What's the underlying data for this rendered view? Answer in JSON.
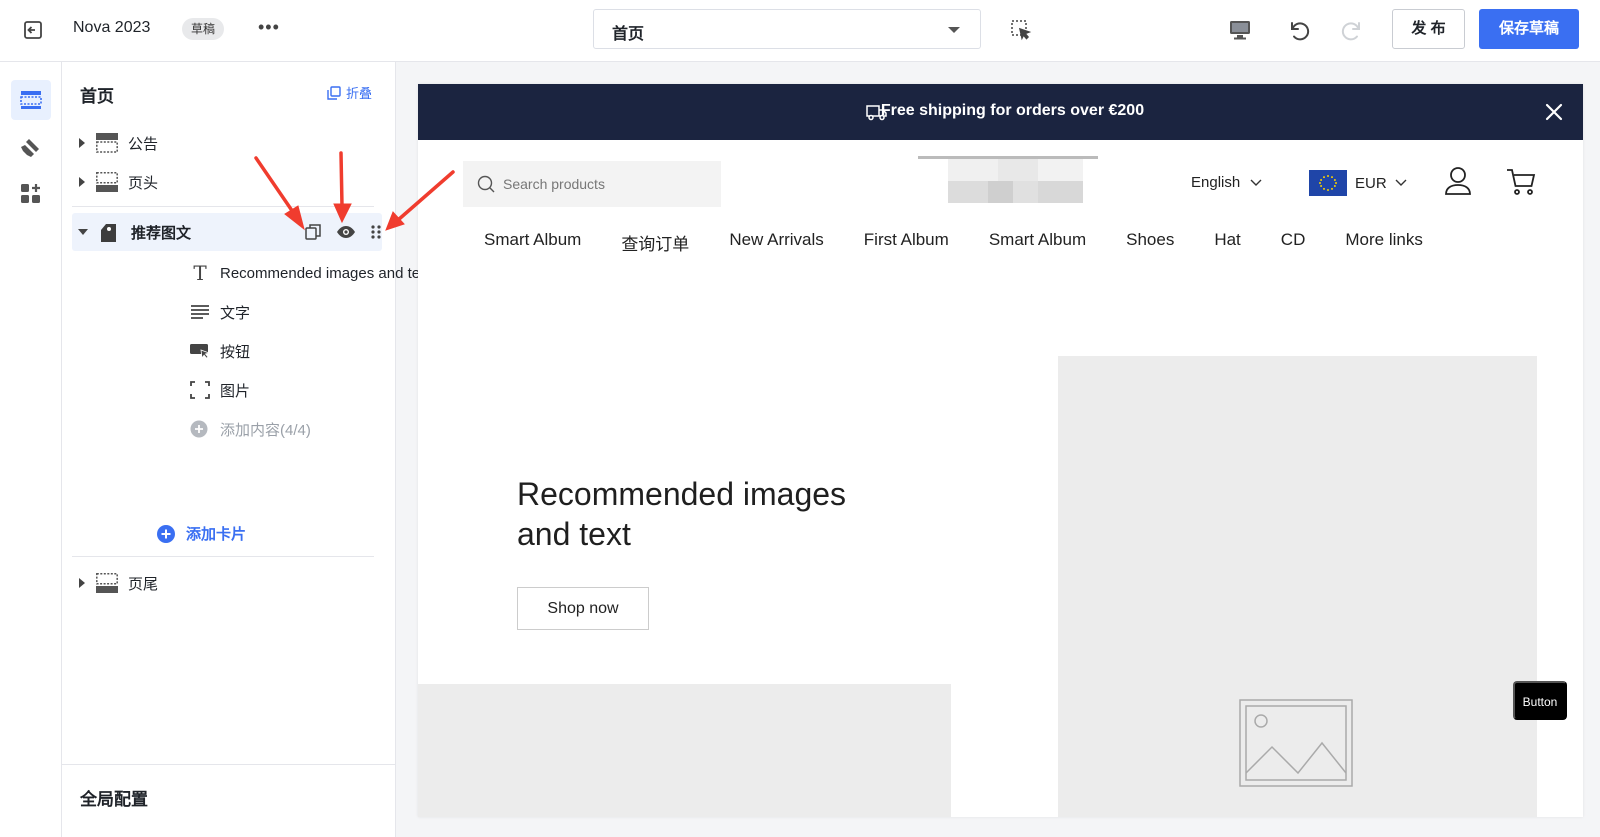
{
  "topbar": {
    "title": "Nova 2023",
    "badge": "草稿",
    "more": "•••",
    "page_select_value": "首页",
    "publish_label": "发 布",
    "save_label": "保存草稿"
  },
  "rail": {
    "items": [
      {
        "name": "sections-icon",
        "active": true
      },
      {
        "name": "theme-style-icon",
        "active": false
      },
      {
        "name": "apps-icon",
        "active": false
      }
    ]
  },
  "sidebar": {
    "title": "首页",
    "collapse_label": "折叠",
    "sections": {
      "announcement": "公告",
      "header": "页头",
      "featured": "推荐图文",
      "footer": "页尾"
    },
    "featured_children": [
      {
        "icon": "text-icon",
        "label": "Recommended images and te..."
      },
      {
        "icon": "paragraph-icon",
        "label": "文字"
      },
      {
        "icon": "button-icon",
        "label": "按钮"
      },
      {
        "icon": "image-icon",
        "label": "图片"
      }
    ],
    "add_content_label": "添加内容(4/4)",
    "add_card_label": "添加卡片",
    "global_config_label": "全局配置"
  },
  "preview": {
    "announcement": "Free shipping for orders over €200",
    "search_placeholder": "Search products",
    "language": "English",
    "currency": "EUR",
    "nav": [
      "Smart Album",
      "查询订单",
      "New Arrivals",
      "First Album",
      "Smart Album",
      "Shoes",
      "Hat",
      "CD",
      "More links"
    ],
    "hero_title": "Recommended images and text",
    "hero_button": "Shop now",
    "floating_button": "Button"
  },
  "colors": {
    "accent": "#3a6ff2",
    "announcement_bg": "#1b2440",
    "annotation_arrow": "#f03c2e"
  }
}
